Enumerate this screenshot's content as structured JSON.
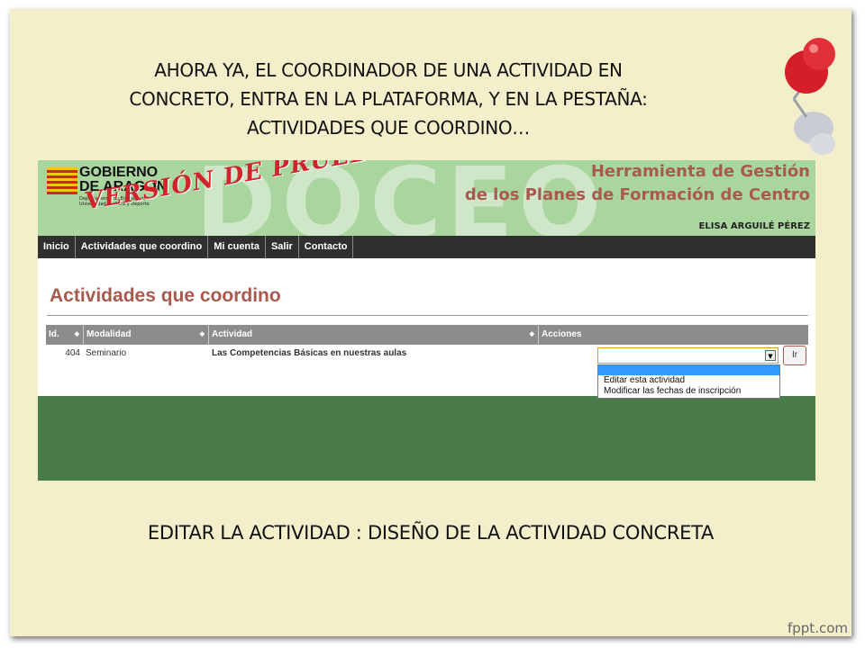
{
  "slide": {
    "intro_lines": [
      "AHORA YA, EL COORDINADOR DE UNA ACTIVIDAD EN",
      "CONCRETO, ENTRA EN LA PLATAFORMA, Y EN LA PESTAÑA:",
      "ACTIVIDADES QUE COORDINO…"
    ],
    "bottom_note": "EDITAR LA ACTIVIDAD : DISEÑO DE LA ACTIVIDAD CONCRETA",
    "watermark": "fppt.com"
  },
  "app": {
    "logo_line1": "GOBIERNO",
    "logo_line2": "DE ARAGON",
    "logo_dept": "Departamento de Educación, Universidad, Cultura y Deporte",
    "test_stamp": "VERSIÓN DE PRUEBAS",
    "background_word": "DOCEO",
    "title_line1": "Herramienta de Gestión",
    "title_line2": "de los Planes de Formación de Centro",
    "user_name": "ELISA ARGUILÉ PÉREZ"
  },
  "nav": {
    "items": [
      "Inicio",
      "Actividades que coordino",
      "Mi cuenta",
      "Salir",
      "Contacto"
    ]
  },
  "page": {
    "title": "Actividades que coordino"
  },
  "table": {
    "headers": [
      "Id.",
      "Modalidad",
      "Actividad",
      "Acciones"
    ],
    "rows": [
      {
        "id": "404",
        "modalidad": "Seminario",
        "actividad": "Las Competencias Básicas en nuestras aulas"
      }
    ]
  },
  "actions": {
    "select_value": "",
    "go_label": "Ir",
    "options": [
      "Editar esta actividad",
      "Modificar las fechas de inscripción"
    ]
  },
  "colors": {
    "slide_bg": "#f4efcb",
    "banner_green": "#a9d69e",
    "title_brown": "#a85a4e",
    "stamp_red": "#d0242a",
    "footer_green": "#4a7c4a",
    "selection_blue": "#3399ff"
  }
}
